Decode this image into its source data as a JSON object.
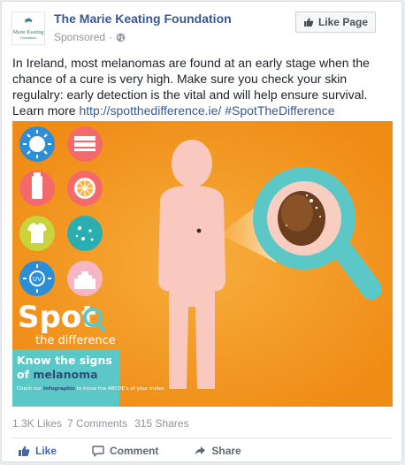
{
  "post": {
    "page_name": "The Marie Keating Foundation",
    "sponsored": "Sponsored",
    "meta_separator": "·",
    "like_page_label": "Like Page",
    "logo": {
      "name": "The Marie Keating Foundation logo",
      "line1": "Marie Keating",
      "line2": "Foundation"
    },
    "body_text": "In Ireland, most melanomas are found at an early stage when the chance of a cure is very high. Make sure you check your skin regulalry: early detection is the vital and will help ensure survival. Learn more",
    "link_text": "http://spotthedifference.ie/",
    "hashtag": "#SpotTheDifference"
  },
  "ad": {
    "headline_word": "Spot",
    "subline": "the difference",
    "box_title_line1": "Know the signs",
    "box_title_prefix": "of ",
    "box_title_highlight": "melanoma",
    "box_body_pre": "Check our ",
    "box_body_highlight": "Infographic",
    "box_body_post": " to know the ABCDE's of your moles",
    "background_color": "#f39a1e",
    "accent_color": "#5bc8c7",
    "icons": [
      "sun-icon",
      "towel-icon",
      "sunscreen-icon",
      "orange-slice-icon",
      "tshirt-icon",
      "moles-icon",
      "uv-sun-icon",
      "sandcastle-icon"
    ]
  },
  "stats": {
    "likes": "1.3K Likes",
    "comments": "7 Comments",
    "shares": "315 Shares"
  },
  "actions": {
    "like": "Like",
    "comment": "Comment",
    "share": "Share"
  },
  "colors": {
    "link": "#365899",
    "like_blue": "#4267b2",
    "muted": "#90949c"
  }
}
